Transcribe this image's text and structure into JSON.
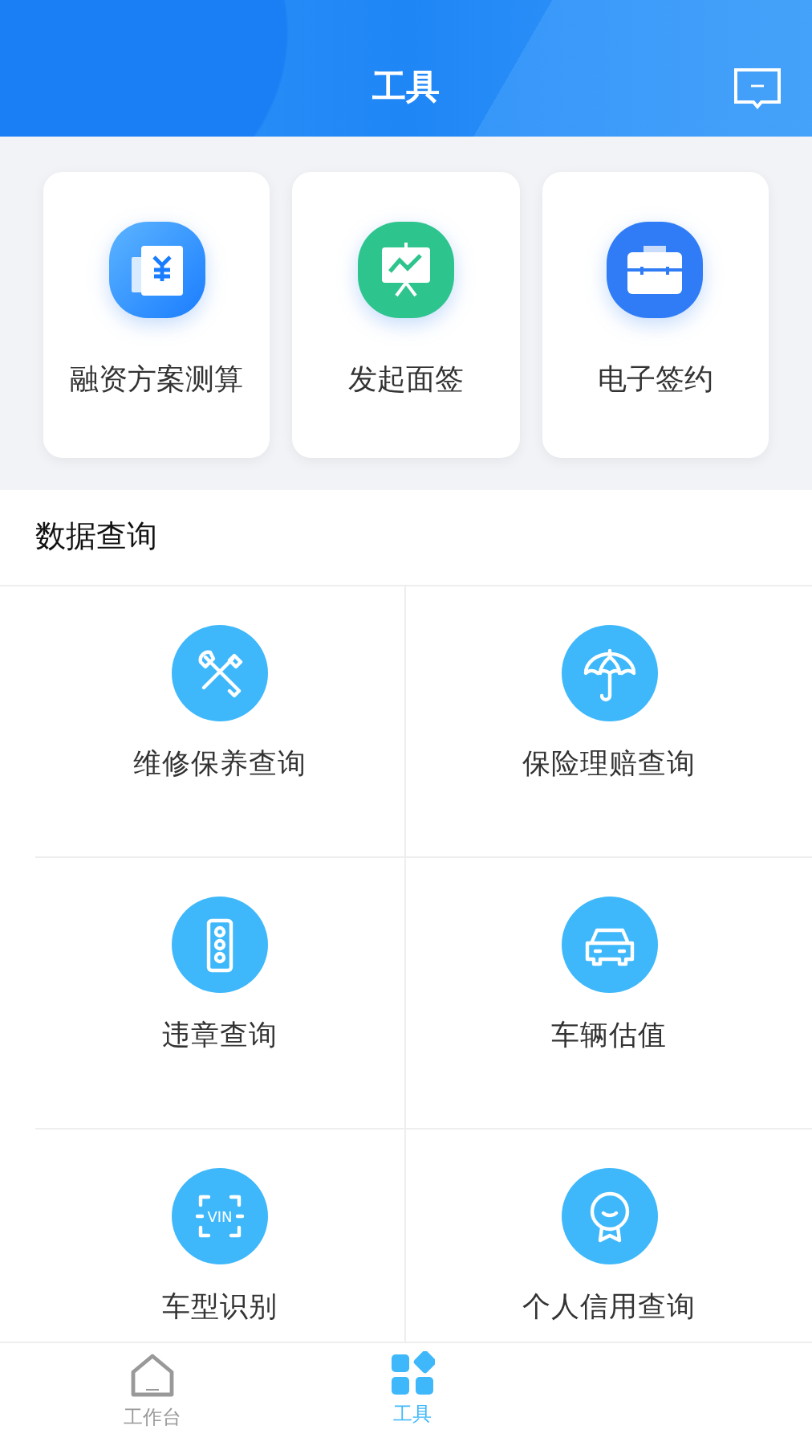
{
  "header": {
    "title": "工具"
  },
  "quick_tools": [
    {
      "label": "融资方案测算"
    },
    {
      "label": "发起面签"
    },
    {
      "label": "电子签约"
    }
  ],
  "data_query": {
    "title": "数据查询",
    "items": [
      {
        "label": "维修保养查询"
      },
      {
        "label": "保险理赔查询"
      },
      {
        "label": "违章查询"
      },
      {
        "label": "车辆估值"
      },
      {
        "label": "车型识别",
        "icon_text": "VIN"
      },
      {
        "label": "个人信用查询"
      }
    ]
  },
  "tab_bar": [
    {
      "label": "工作台",
      "selected": false
    },
    {
      "label": "工具",
      "selected": true
    }
  ]
}
